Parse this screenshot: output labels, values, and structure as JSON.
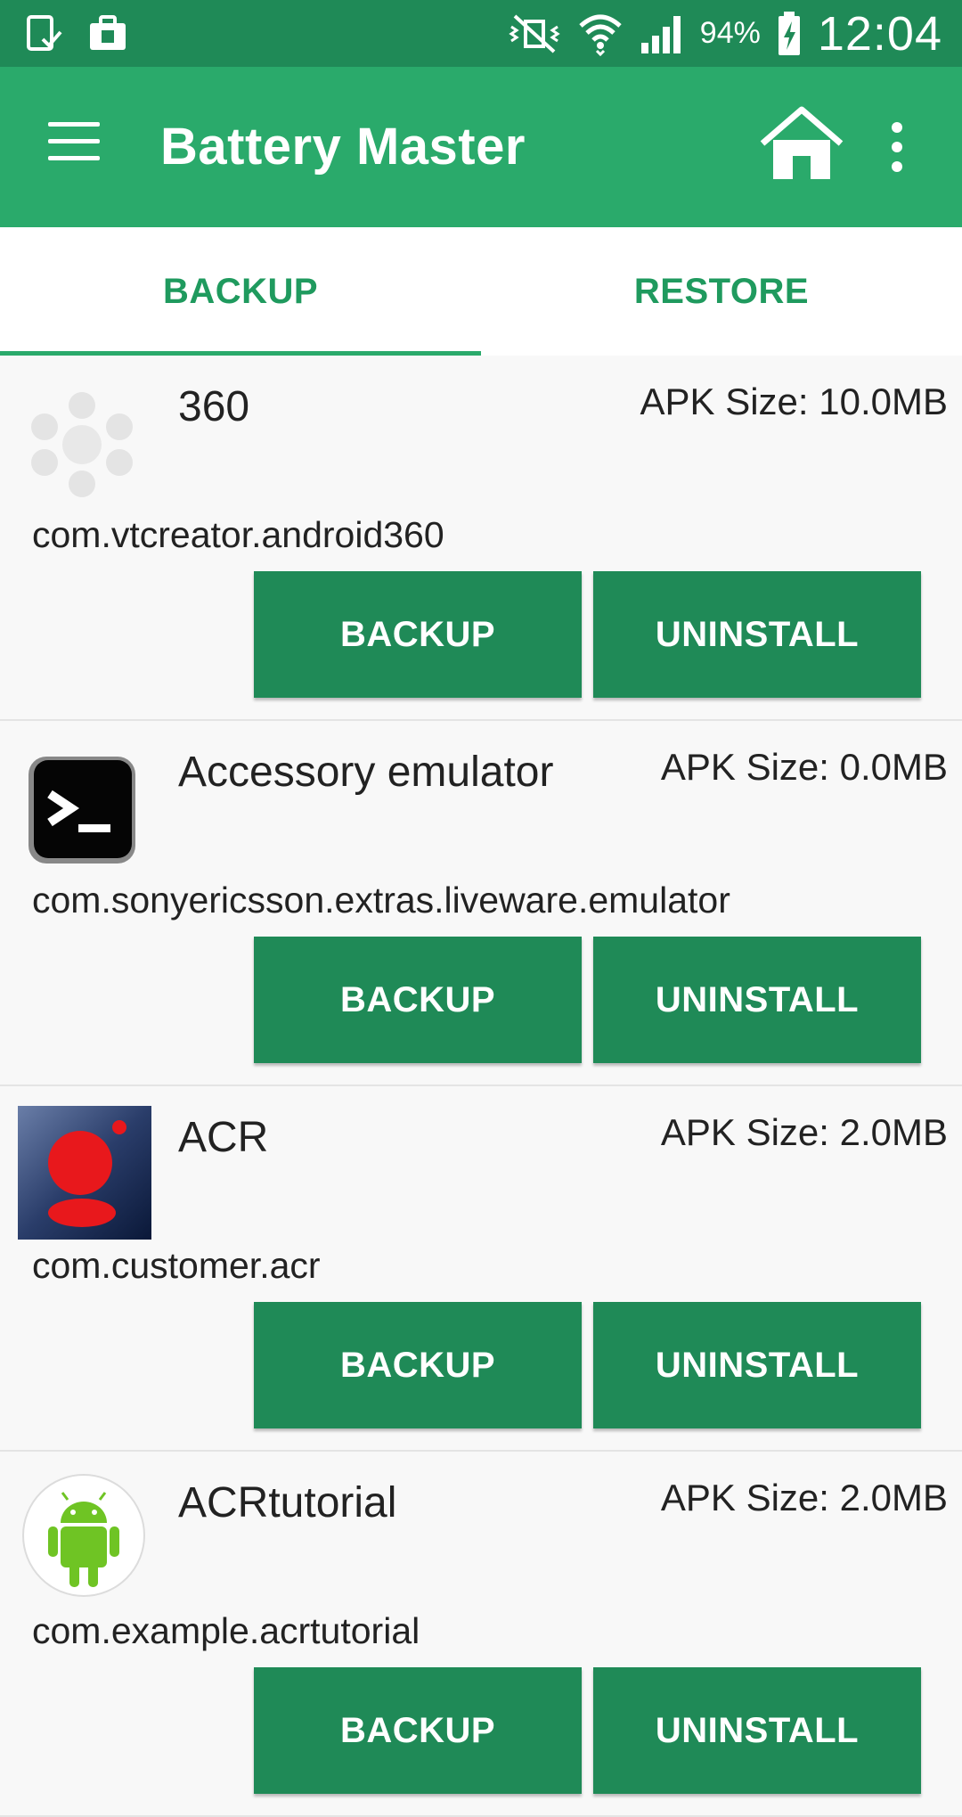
{
  "status_bar": {
    "battery_percent": "94%",
    "time": "12:04",
    "icons": [
      "download-done-icon",
      "briefcase-icon",
      "mute-vibrate-icon",
      "wifi-icon",
      "signal-icon",
      "battery-charging-icon"
    ]
  },
  "app_bar": {
    "title": "Battery Master",
    "icons": [
      "menu-icon",
      "home-icon",
      "more-vert-icon"
    ]
  },
  "tabs": [
    {
      "label": "BACKUP",
      "active": true
    },
    {
      "label": "RESTORE",
      "active": false
    }
  ],
  "apps": [
    {
      "name": "360",
      "apk_size": "APK Size: 10.0MB",
      "package": "com.vtcreator.android360",
      "icon": "360-dots-icon",
      "backup_label": "BACKUP",
      "uninstall_label": "UNINSTALL"
    },
    {
      "name": "Accessory emulator",
      "apk_size": "APK Size: 0.0MB",
      "package": "com.sonyericsson.extras.liveware.emulator",
      "icon": "terminal-icon",
      "backup_label": "BACKUP",
      "uninstall_label": "UNINSTALL"
    },
    {
      "name": "ACR",
      "apk_size": "APK Size: 2.0MB",
      "package": "com.customer.acr",
      "icon": "acr-icon",
      "backup_label": "BACKUP",
      "uninstall_label": "UNINSTALL"
    },
    {
      "name": "ACRtutorial",
      "apk_size": "APK Size: 2.0MB",
      "package": "com.example.acrtutorial",
      "icon": "android-icon",
      "backup_label": "BACKUP",
      "uninstall_label": "UNINSTALL"
    }
  ],
  "colors": {
    "status_bar": "#1f8a57",
    "app_bar": "#2aaa6b",
    "accent": "#1f9a5e",
    "button": "#1f8a57",
    "background": "#f8f8f8"
  }
}
